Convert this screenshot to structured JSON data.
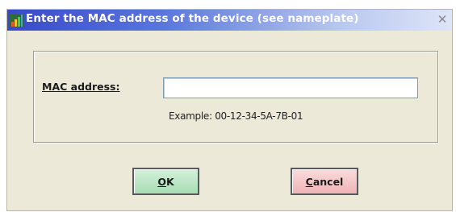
{
  "window": {
    "title": "Enter the MAC address of the device (see nameplate)",
    "close_glyph": "✕"
  },
  "form": {
    "mac_label": "MAC address:",
    "mac_value": "",
    "mac_placeholder": "",
    "example": "Example: 00-12-34-5A-7B-01"
  },
  "buttons": {
    "ok_mnemonic": "O",
    "ok_rest": "K",
    "cancel_mnemonic": "C",
    "cancel_rest": "ancel"
  },
  "colors": {
    "titlebar_start": "#3a48c8",
    "dialog_bg": "#ece9d8",
    "ok_bg": "#a7dcb3",
    "cancel_bg": "#f0b3b6"
  },
  "icons": {
    "app": "bar-chart-icon",
    "close": "close-icon"
  }
}
